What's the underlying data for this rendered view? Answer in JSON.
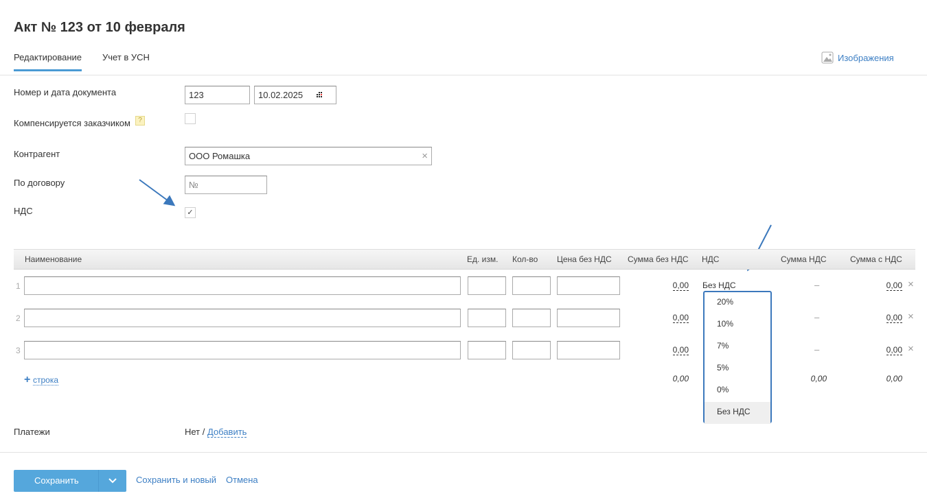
{
  "title": "Акт № 123 от 10 февраля",
  "tabs": [
    {
      "label": "Редактирование",
      "active": true
    },
    {
      "label": "Учет в УСН",
      "active": false
    }
  ],
  "images_link": "Изображения",
  "form": {
    "doc_label": "Номер и дата документа",
    "doc_number": "123",
    "doc_date": "10.02.2025",
    "compensated_label": "Компенсируется заказчиком",
    "help": "?",
    "compensated_checked": false,
    "counterparty_label": "Контрагент",
    "counterparty_value": "ООО Ромашка",
    "contract_label": "По договору",
    "contract_placeholder": "№",
    "vat_label": "НДС",
    "vat_checked": true,
    "check": "✓"
  },
  "table": {
    "headers": [
      "Наименование",
      "Ед. изм.",
      "Кол-во",
      "Цена без НДС",
      "Сумма без НДС",
      "НДС",
      "Сумма НДС",
      "Сумма с НДС"
    ],
    "rows": [
      {
        "n": "1",
        "sum": "0,00",
        "vat": "Без НДС",
        "vat_sum": "–",
        "total": "0,00"
      },
      {
        "n": "2",
        "sum": "0,00",
        "vat": "",
        "vat_sum": "–",
        "total": "0,00"
      },
      {
        "n": "3",
        "sum": "0,00",
        "vat": "",
        "vat_sum": "–",
        "total": "0,00"
      }
    ],
    "totals": {
      "sum": "0,00",
      "vat_sum": "0,00",
      "total": "0,00"
    },
    "add_row": "строка",
    "plus": "+",
    "remove": "×"
  },
  "vat_dropdown": {
    "options": [
      "20%",
      "10%",
      "7%",
      "5%",
      "0%",
      "Без НДС"
    ],
    "selected": "Без НДС"
  },
  "payments": {
    "label": "Платежи",
    "none": "Нет /",
    "add": "Добавить"
  },
  "footer": {
    "save": "Сохранить",
    "save_new": "Сохранить и новый",
    "cancel": "Отмена"
  },
  "colors": {
    "accent": "#55a7dc",
    "link": "#3d7fc4",
    "arrow": "#3b78bc"
  }
}
